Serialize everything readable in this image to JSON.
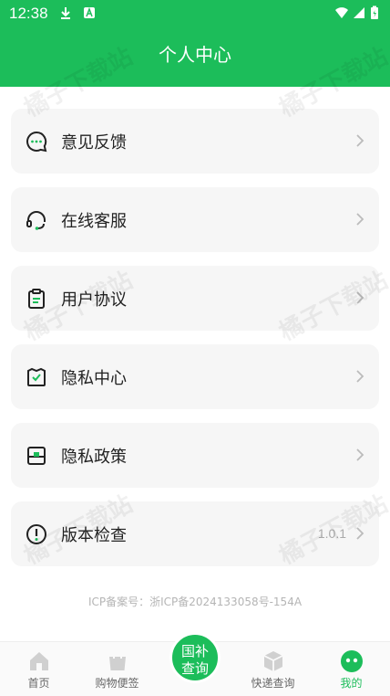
{
  "status": {
    "time": "12:38"
  },
  "header": {
    "title": "个人中心"
  },
  "menu": [
    {
      "label": "意见反馈",
      "icon": "feedback-chat-icon"
    },
    {
      "label": "在线客服",
      "icon": "headset-icon"
    },
    {
      "label": "用户协议",
      "icon": "clipboard-icon"
    },
    {
      "label": "隐私中心",
      "icon": "shield-check-box-icon"
    },
    {
      "label": "隐私政策",
      "icon": "privacy-doc-icon"
    },
    {
      "label": "版本检查",
      "icon": "info-circle-icon",
      "value": "1.0.1"
    }
  ],
  "icp": "ICP备案号：浙ICP备2024133058号-154A",
  "tabs": [
    {
      "label": "首页",
      "icon": "home-icon"
    },
    {
      "label": "购物便签",
      "icon": "shopping-bag-icon"
    },
    {
      "label": "快递查询",
      "icon": "package-box-icon"
    },
    {
      "label": "我的",
      "icon": "profile-face-icon",
      "active": true
    }
  ],
  "center_button": {
    "line1": "国补",
    "line2": "查询"
  },
  "watermark": "橘子下载站",
  "colors": {
    "accent": "#1cbd5a",
    "card": "#f6f6f6"
  }
}
